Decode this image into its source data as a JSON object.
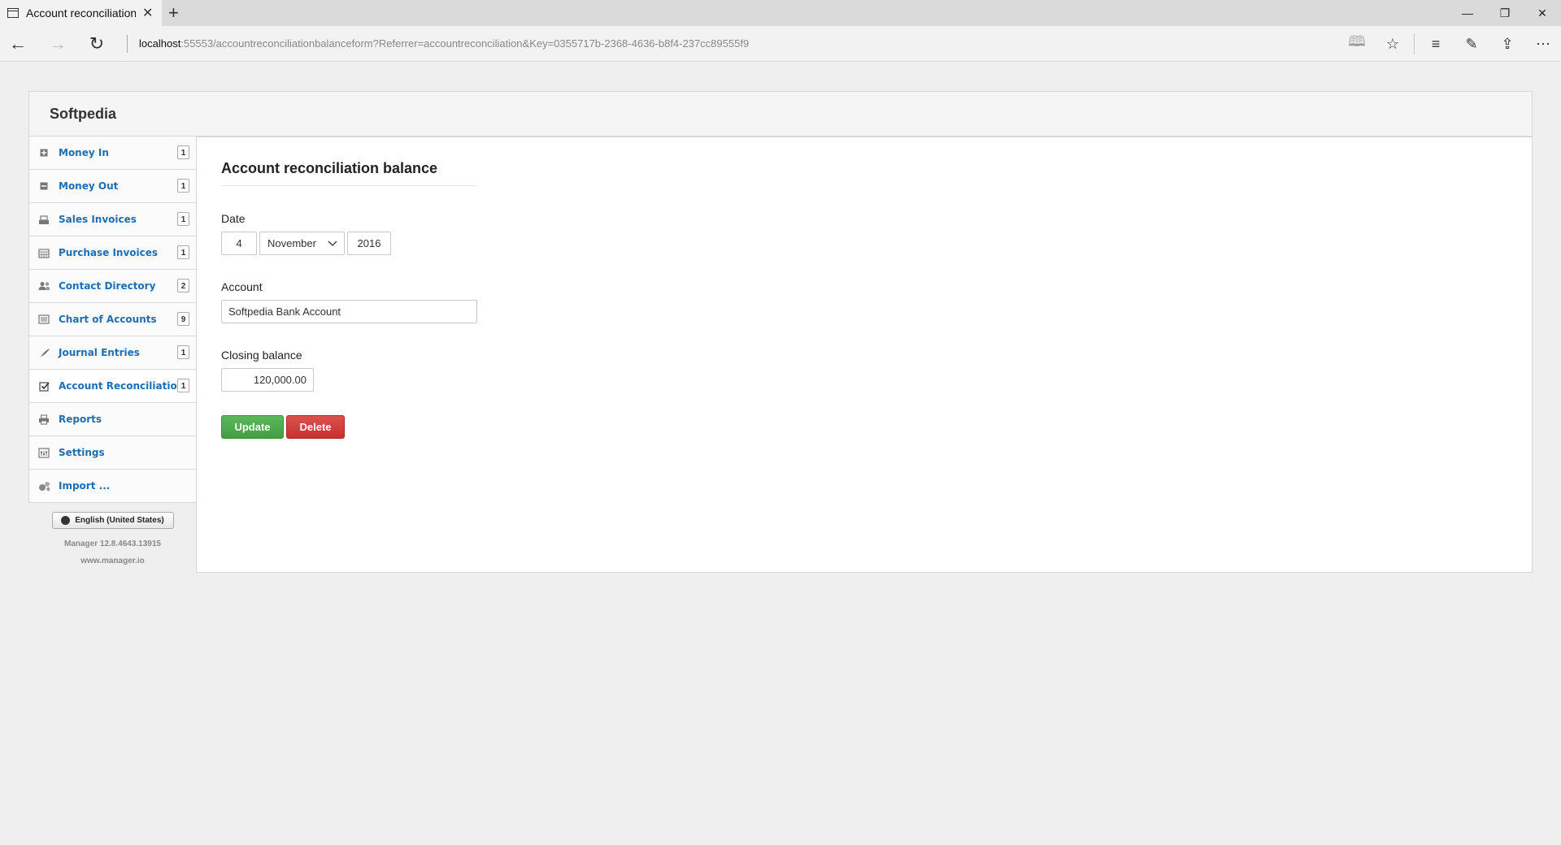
{
  "browser": {
    "tab_title": "Account reconciliation b",
    "tab_close": "✕",
    "new_tab": "+",
    "address_host": "localhost",
    "address_rest": ":55553/accountreconciliationbalanceform?Referrer=accountreconciliation&Key=0355717b-2368-4636-b8f4-237cc89555f9",
    "icons": [
      "back-icon",
      "forward-icon",
      "refresh-icon",
      "reading-view-icon",
      "favorite-star-icon",
      "hub-icon",
      "web-note-icon",
      "share-icon",
      "more-icon"
    ]
  },
  "app": {
    "business_name": "Softpedia",
    "sidebar": [
      {
        "label": "Money In",
        "count": "1",
        "icon": "plus-box-icon"
      },
      {
        "label": "Money Out",
        "count": "1",
        "icon": "minus-box-icon"
      },
      {
        "label": "Sales Invoices",
        "count": "1",
        "icon": "cash-register-icon"
      },
      {
        "label": "Purchase Invoices",
        "count": "1",
        "icon": "calendar-icon"
      },
      {
        "label": "Contact Directory",
        "count": "2",
        "icon": "people-icon"
      },
      {
        "label": "Chart of Accounts",
        "count": "9",
        "icon": "ledger-icon"
      },
      {
        "label": "Journal Entries",
        "count": "1",
        "icon": "quill-icon"
      },
      {
        "label": "Account Reconciliation",
        "count": "1",
        "icon": "checkbox-icon"
      },
      {
        "label": "Reports",
        "count": "",
        "icon": "printer-icon"
      },
      {
        "label": "Settings",
        "count": "",
        "icon": "settings-icon"
      },
      {
        "label": "Import ...",
        "count": "",
        "icon": "import-icon"
      }
    ],
    "language_button": "English (United States)",
    "version": "Manager 12.8.4643.13915",
    "website": "www.manager.io"
  },
  "form": {
    "title": "Account reconciliation balance",
    "date_label": "Date",
    "date_day": "4",
    "date_month": "November",
    "date_year": "2016",
    "account_label": "Account",
    "account_value": "Softpedia Bank Account",
    "closing_label": "Closing balance",
    "closing_value": "120,000.00",
    "update_button": "Update",
    "delete_button": "Delete"
  },
  "colors": {
    "link": "#1f6eb3",
    "update": "#4cae4c",
    "delete": "#d9534f"
  }
}
